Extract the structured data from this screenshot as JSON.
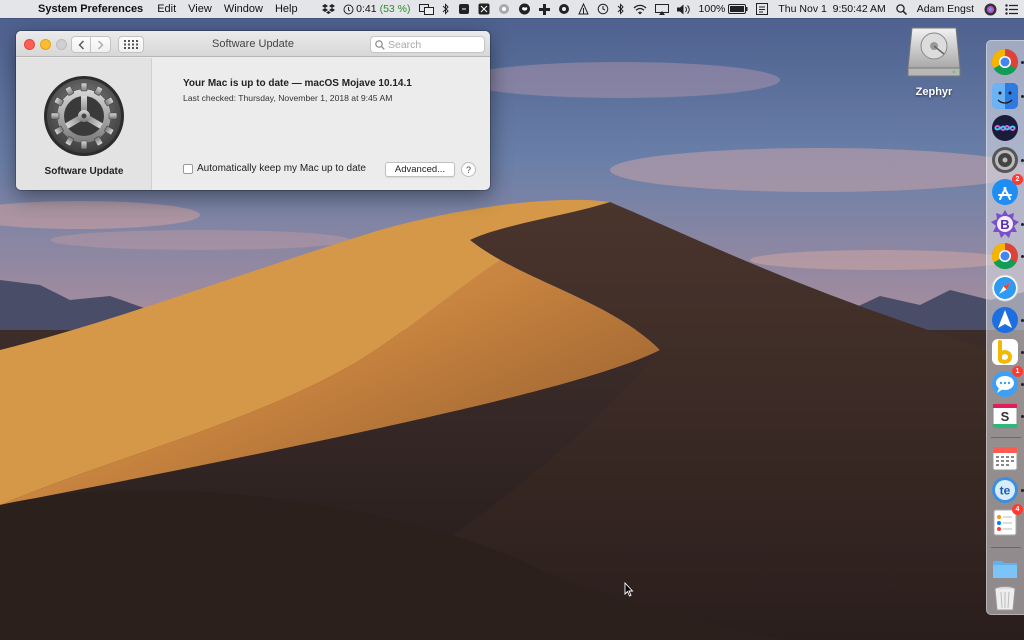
{
  "menubar": {
    "app_name": "System Preferences",
    "menus": [
      "Edit",
      "View",
      "Window",
      "Help"
    ],
    "battery_time": "0:41",
    "battery_percent": "(53 %)",
    "battery_level": "100%",
    "datetime": "Thu Nov 1  9:50:42 AM",
    "user": "Adam Engst"
  },
  "window": {
    "title": "Software Update",
    "search_placeholder": "Search",
    "sidebar_label": "Software Update",
    "status_title": "Your Mac is up to date — macOS Mojave 10.14.1",
    "last_checked": "Last checked: Thursday, November 1, 2018 at 9:45 AM",
    "auto_update_label": "Automatically keep my Mac up to date",
    "auto_update_checked": false,
    "advanced_label": "Advanced...",
    "help_label": "?"
  },
  "desktop": {
    "hd_label": "Zephyr"
  },
  "dock": {
    "badges": {
      "app_store": "2",
      "messages": "1",
      "reminders": "4"
    }
  },
  "colors": {
    "close": "#fc5f57",
    "minimize": "#fdbd2e",
    "battery_green": "#2e8b2e",
    "badge_red": "#ff3b30"
  }
}
